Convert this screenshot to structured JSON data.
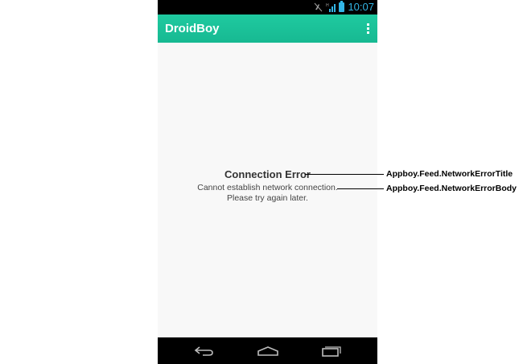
{
  "status_bar": {
    "time": "10:07",
    "icons": [
      "muted-icon",
      "signal-icon",
      "battery-icon"
    ],
    "accent_color": "#33b5e5"
  },
  "action_bar": {
    "title": "DroidBoy",
    "overflow_icon": "overflow-menu-icon",
    "color": "#1fc39c"
  },
  "feed": {
    "error_title": "Connection Error",
    "error_body": [
      "Cannot establish network connection.",
      "Please try again later."
    ]
  },
  "nav_bar": {
    "buttons": [
      "back-icon",
      "home-icon",
      "recent-apps-icon"
    ]
  },
  "annotations": {
    "title_label": "Appboy.Feed.NetworkErrorTitle",
    "body_label": "Appboy.Feed.NetworkErrorBody"
  }
}
